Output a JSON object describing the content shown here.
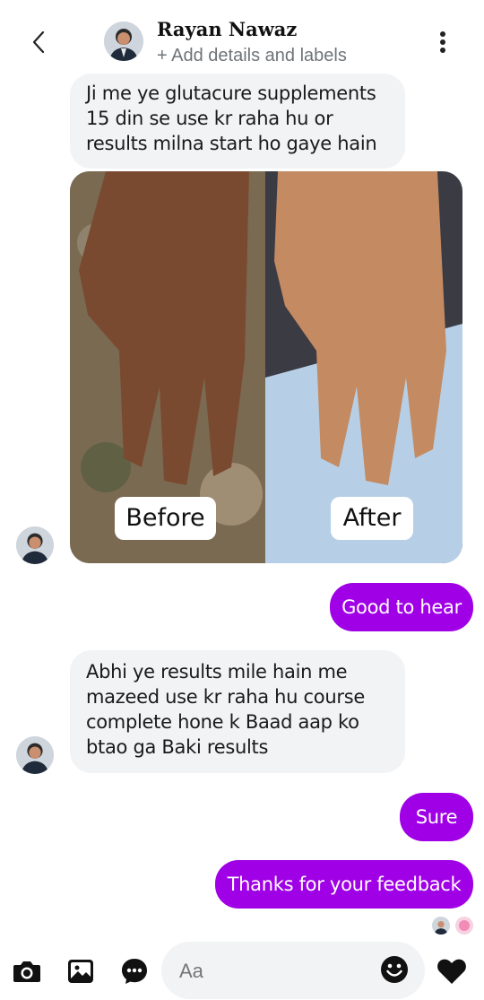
{
  "header": {
    "contact_name": "Rayan Nawaz",
    "subtitle": "+ Add details and labels",
    "back_icon": "chevron-left-icon",
    "more_icon": "vertical-dots-icon"
  },
  "messages": [
    {
      "direction": "incoming",
      "text": "Ji me ye glutacure supplements 15 din se use kr raha hu or results milna start ho gaye hain"
    },
    {
      "direction": "incoming",
      "type": "photo",
      "labels": [
        "Before",
        "After"
      ]
    },
    {
      "direction": "outgoing",
      "text": "Good to hear"
    },
    {
      "direction": "incoming",
      "text": "Abhi ye results mile hain me mazeed use kr raha hu course complete hone k Baad aap ko btao ga Baki results"
    },
    {
      "direction": "outgoing",
      "text": "Sure"
    },
    {
      "direction": "outgoing",
      "text": "Thanks for your feedback"
    }
  ],
  "composer": {
    "placeholder": "Aa",
    "value": "",
    "icons": [
      "camera-icon",
      "gallery-icon",
      "chat-bubble-icon",
      "emoji-icon",
      "heart-icon"
    ]
  },
  "colors": {
    "outgoing_bubble": "#a000e6",
    "incoming_bubble": "#f1f3f5",
    "background": "#ffffff"
  }
}
